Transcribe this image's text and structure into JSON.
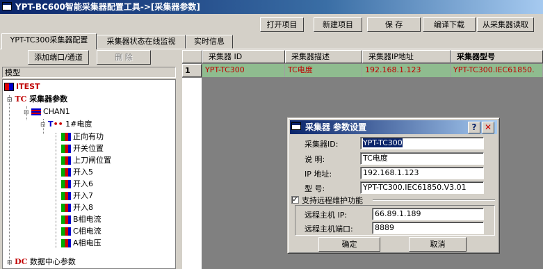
{
  "window": {
    "title": "YPT-BC600智能采集器配置工具->[采集器参数]"
  },
  "toolbar": {
    "open": "打开项目",
    "new": "新建项目",
    "save": "保  存",
    "compile": "编译下载",
    "read": "从采集器读取"
  },
  "tabs": [
    "YPT-TC300采集器配置",
    "采集器状态在线监视",
    "实时信息"
  ],
  "left": {
    "add_btn": "添加端口/通道",
    "delete_btn": "删 除",
    "model_label": "模型"
  },
  "tree": {
    "root": "ITEST",
    "tc_prefix": "TC",
    "tc_label": "采集器参数",
    "chan": "CHAN1",
    "meter_prefix": "T",
    "meter": "1#电度",
    "points": [
      "正向有功",
      "开关位置",
      "上刀闸位置",
      "开入5",
      "开入6",
      "开入7",
      "开入8",
      "B相电流",
      "C相电流",
      "A相电压"
    ],
    "dc_prefix": "DC",
    "dc_label": "数据中心参数"
  },
  "grid": {
    "headers": [
      "采集器  ID",
      "采集器描述",
      "采集器IP地址",
      "采集器型号"
    ],
    "row_num": "1",
    "rows": [
      [
        "YPT-TC300",
        "TC电度",
        "192.168.1.123",
        "YPT-TC300.IEC61850."
      ]
    ]
  },
  "dialog": {
    "title": "采集器 参数设置",
    "help": "?",
    "close": "✕",
    "id_label": "采集器ID:",
    "id_value": "YPT-TC300",
    "desc_label": "说    明:",
    "desc_value": "TC电度",
    "ip_label": "IP  地址:",
    "ip_value": "192.168.1.123",
    "model_label": "型    号:",
    "model_value": "YPT-TC300.IEC61850.V3.01",
    "remote_check": "支持远程维护功能",
    "remote_checked": "✓",
    "remote_ip_label": "远程主机  IP:",
    "remote_ip_value": "66.89.1.189",
    "remote_port_label": "远程主机端口:",
    "remote_port_value": "8889",
    "ok": "确定",
    "cancel": "取消"
  },
  "colors": {
    "title_start": "#0a246a",
    "title_end": "#a6caf0",
    "row_bg": "#8fbc8f",
    "row_text": "#c00000"
  }
}
